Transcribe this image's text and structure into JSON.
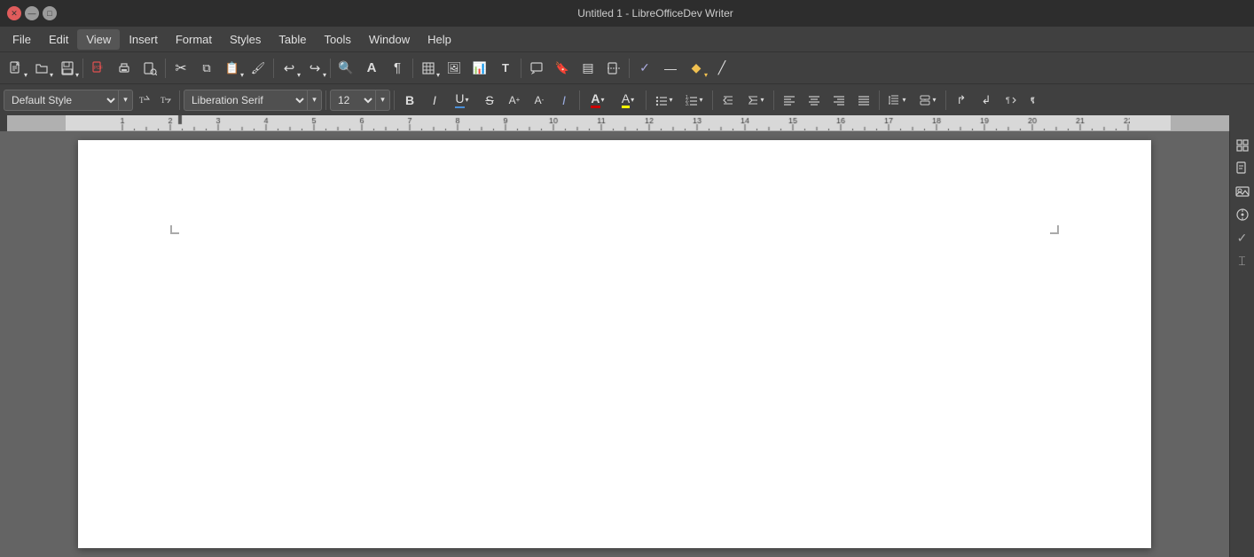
{
  "titlebar": {
    "title": "Untitled 1 - LibreOfficeDev Writer",
    "close_label": "✕",
    "minimize_label": "—",
    "maximize_label": "□"
  },
  "menubar": {
    "items": [
      {
        "id": "file",
        "label": "File"
      },
      {
        "id": "edit",
        "label": "Edit"
      },
      {
        "id": "view",
        "label": "View"
      },
      {
        "id": "insert",
        "label": "Insert"
      },
      {
        "id": "format",
        "label": "Format"
      },
      {
        "id": "styles",
        "label": "Styles"
      },
      {
        "id": "table",
        "label": "Table"
      },
      {
        "id": "tools",
        "label": "Tools"
      },
      {
        "id": "window",
        "label": "Window"
      },
      {
        "id": "help",
        "label": "Help"
      }
    ]
  },
  "toolbar1": {
    "buttons": [
      {
        "id": "new",
        "icon": "≡",
        "tooltip": "New",
        "has_arrow": true
      },
      {
        "id": "open",
        "icon": "📂",
        "tooltip": "Open",
        "has_arrow": true
      },
      {
        "id": "save",
        "icon": "💾",
        "tooltip": "Save",
        "has_arrow": true
      },
      {
        "sep": true
      },
      {
        "id": "export-pdf",
        "icon": "📄",
        "tooltip": "Export as PDF"
      },
      {
        "id": "print",
        "icon": "🖨",
        "tooltip": "Print"
      },
      {
        "id": "print-preview",
        "icon": "🔍",
        "tooltip": "Print Preview"
      },
      {
        "sep": true
      },
      {
        "id": "cut",
        "icon": "✂",
        "tooltip": "Cut"
      },
      {
        "id": "copy",
        "icon": "⧉",
        "tooltip": "Copy"
      },
      {
        "id": "paste",
        "icon": "📋",
        "tooltip": "Paste",
        "has_arrow": true
      },
      {
        "id": "clone-format",
        "icon": "🖌",
        "tooltip": "Clone Formatting"
      },
      {
        "sep": true
      },
      {
        "id": "undo",
        "icon": "↩",
        "tooltip": "Undo",
        "has_arrow": true
      },
      {
        "id": "redo",
        "icon": "↪",
        "tooltip": "Redo",
        "has_arrow": true
      },
      {
        "sep": true
      },
      {
        "id": "find",
        "icon": "🔍",
        "tooltip": "Find"
      },
      {
        "id": "big-a",
        "icon": "A",
        "tooltip": "Formatting Marks"
      },
      {
        "id": "pilcrow",
        "icon": "¶",
        "tooltip": "Pilcrow"
      },
      {
        "sep": true
      },
      {
        "id": "table-insert",
        "icon": "⊞",
        "tooltip": "Insert Table",
        "has_arrow": true
      },
      {
        "id": "image",
        "icon": "🖼",
        "tooltip": "Insert Image"
      },
      {
        "id": "chart",
        "icon": "📊",
        "tooltip": "Insert Chart"
      },
      {
        "id": "textbox",
        "icon": "T",
        "tooltip": "Insert Text Box"
      },
      {
        "sep": true
      },
      {
        "id": "comment",
        "icon": "💬",
        "tooltip": "Insert Comment"
      },
      {
        "id": "bookmark",
        "icon": "🔖",
        "tooltip": "Insert Bookmark"
      },
      {
        "id": "field",
        "icon": "▤",
        "tooltip": "Insert Field"
      },
      {
        "id": "pagebreak",
        "icon": "⊟",
        "tooltip": "Insert Page Break"
      },
      {
        "sep": true
      },
      {
        "id": "spellcheck",
        "icon": "✓",
        "tooltip": "Spellcheck"
      },
      {
        "id": "hyphen",
        "icon": "—",
        "tooltip": "Insert Hyphen"
      },
      {
        "id": "shapes",
        "icon": "◆",
        "tooltip": "Shapes",
        "has_arrow": true
      },
      {
        "id": "draw-line",
        "icon": "╱",
        "tooltip": "Draw Line"
      }
    ]
  },
  "format_toolbar": {
    "style": {
      "value": "Default Style",
      "placeholder": "Default Style"
    },
    "style_extra_btns": [
      "T↑",
      "T↓"
    ],
    "font": {
      "value": "Liberation Serif"
    },
    "font_size": {
      "value": "12"
    },
    "bold_label": "B",
    "italic_label": "I",
    "underline_label": "U",
    "strikethrough_label": "S",
    "superscript_label": "A",
    "subscript_label": "A",
    "shadow_label": "I",
    "font_color_label": "A",
    "highlight_label": "A",
    "list_unordered_label": "≡",
    "list_ordered_label": "≡",
    "indent_decrease_label": "◁",
    "indent_increase_label": "▷",
    "align_left_label": "≡",
    "align_center_label": "≡",
    "align_right_label": "≡",
    "align_justify_label": "≡",
    "line_spacing_label": "↕",
    "para_spacing_label": "↕",
    "ltr_label": "↱",
    "rtl_label": "↲"
  },
  "sidebar": {
    "buttons": [
      {
        "id": "properties",
        "icon": "⊞",
        "tooltip": "Properties"
      },
      {
        "id": "styles",
        "icon": "📄",
        "tooltip": "Styles"
      },
      {
        "id": "gallery",
        "icon": "🖼",
        "tooltip": "Gallery"
      },
      {
        "id": "navigator",
        "icon": "⊙",
        "tooltip": "Navigator"
      },
      {
        "id": "validate",
        "icon": "✓",
        "tooltip": "Validate"
      },
      {
        "id": "cursor",
        "icon": "⌶",
        "tooltip": "Cursor"
      }
    ]
  },
  "document": {
    "page_bg": "#ffffff"
  }
}
